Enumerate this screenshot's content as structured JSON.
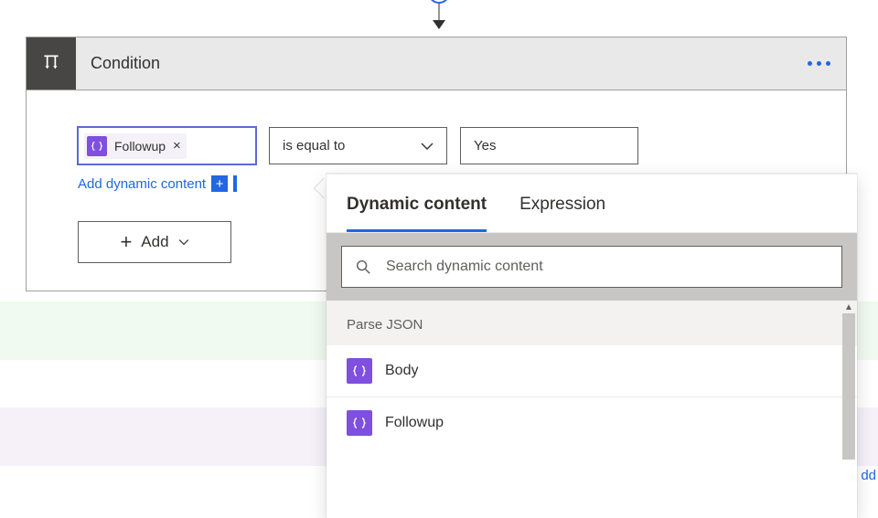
{
  "card": {
    "title": "Condition"
  },
  "row": {
    "token": {
      "label": "Followup"
    },
    "operator": "is equal to",
    "value": "Yes"
  },
  "links": {
    "add_dynamic_content": "Add dynamic content",
    "add_button": "Add",
    "dd_fragment": "dd"
  },
  "panel": {
    "tabs": {
      "dynamic": "Dynamic content",
      "expression": "Expression"
    },
    "search_placeholder": "Search dynamic content",
    "group": "Parse JSON",
    "items": [
      {
        "label": "Body"
      },
      {
        "label": "Followup"
      }
    ]
  }
}
